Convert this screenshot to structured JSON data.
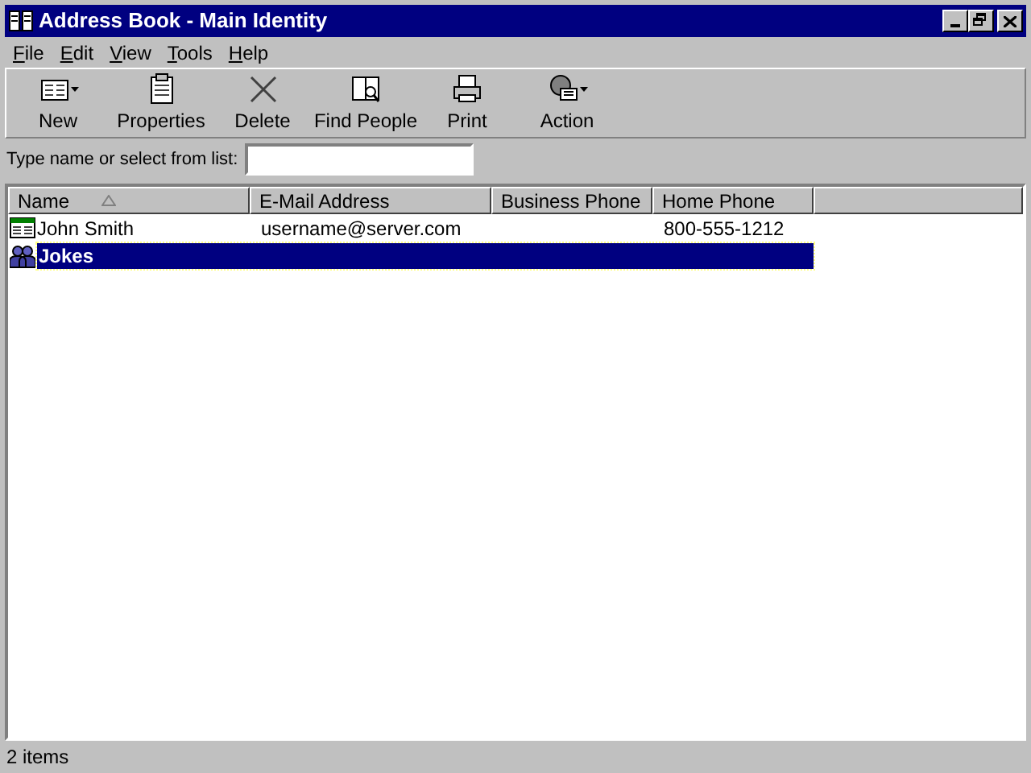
{
  "window": {
    "title": "Address Book - Main Identity"
  },
  "menu": [
    {
      "label": "File"
    },
    {
      "label": "Edit"
    },
    {
      "label": "View"
    },
    {
      "label": "Tools"
    },
    {
      "label": "Help"
    }
  ],
  "toolbar": [
    {
      "label": "New",
      "kind": "new",
      "dropdown": true
    },
    {
      "label": "Properties",
      "kind": "properties",
      "dropdown": false
    },
    {
      "label": "Delete",
      "kind": "delete",
      "dropdown": false
    },
    {
      "label": "Find People",
      "kind": "find",
      "dropdown": false
    },
    {
      "label": "Print",
      "kind": "print",
      "dropdown": false
    },
    {
      "label": "Action",
      "kind": "action",
      "dropdown": true
    }
  ],
  "search": {
    "label": "Type name or select from list:"
  },
  "table": {
    "columns": [
      {
        "label": "Name",
        "sorted": true
      },
      {
        "label": "E-Mail Address",
        "sorted": false
      },
      {
        "label": "Business Phone",
        "sorted": false
      },
      {
        "label": "Home Phone",
        "sorted": false
      }
    ],
    "rows": [
      {
        "kind": "contact",
        "selected": false,
        "cells": [
          "John Smith",
          "username@server.com",
          "",
          "800-555-1212"
        ]
      },
      {
        "kind": "group",
        "selected": true,
        "cells": [
          "Jokes",
          "",
          "",
          ""
        ]
      }
    ]
  },
  "status_bar": {
    "text": "2 items"
  }
}
